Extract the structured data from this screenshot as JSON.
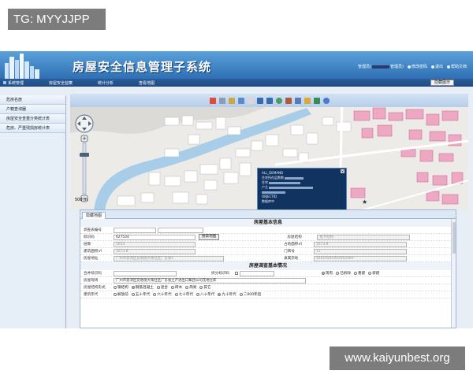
{
  "watermark_tl": "TG: MYYJJPP",
  "watermark_br": "www.kaiyunbest.org",
  "header": {
    "title": "房屋安全信息管理子系统",
    "user_prefix": "管理员(",
    "user_suffix": "管理员)",
    "change_password": "修改密码",
    "logout": "退出",
    "help": "帮助文档"
  },
  "menu": {
    "items": [
      "系统管理",
      "房屋安全监察",
      "统计分析",
      "查看地图"
    ],
    "right_button": "隐藏图示"
  },
  "sidebar": {
    "items": [
      "危房名册",
      "户籍查询器",
      "房屋安全查重分类统计表",
      "危房、严重残损房统计表"
    ]
  },
  "map": {
    "scale_label": "500 m",
    "popup_lines": [
      "ALL_DEMAND",
      "住宅所在层数数",
      "住宅",
      "户主",
      "",
      "OBJECTID",
      "数据库中"
    ]
  },
  "form": {
    "tab": "隐藏地图",
    "section1": "房屋基本信息",
    "section2": "房屋调查基本情况",
    "labels": {
      "survey_no": "调查表编号",
      "barcode": "标识码",
      "structure": "房屋结构",
      "floors": "层数",
      "build_area": "建筑面积㎡",
      "land_area": "占地面积㎡",
      "door_no": "门牌号",
      "address": "房屋地址",
      "property_cert": "房屋地址",
      "same_house": "合并标识码",
      "sub_house": "拆分标识码",
      "site": "房屋现场",
      "struct_type": "房屋结构形式",
      "build_year": "建筑年代",
      "land_no": "隶属宗地"
    },
    "values": {
      "barcode": "627534",
      "search_button": "搜索地图",
      "structure": "基卡结构",
      "floors": "1653",
      "build_area": "1673.8",
      "land_area": "1673.8",
      "door_no": "11",
      "address": "广州市荔湾区花地街大策社区广东省1",
      "land_no": "44010501003052060",
      "site": "广州市荔湾区花地街大策社区广东省土产进出口集团公司花地仓库"
    },
    "status_options": [
      "现有",
      "已拆除",
      "重建",
      "新建"
    ],
    "struct_options": [
      "钢结构",
      "钢筋混凝土",
      "混合",
      "砖木",
      "简易",
      "其它"
    ],
    "year_options": [
      "解放前",
      "五十年代",
      "六十年代",
      "七十年代",
      "八十年代",
      "九十年代",
      "二000年后"
    ]
  }
}
